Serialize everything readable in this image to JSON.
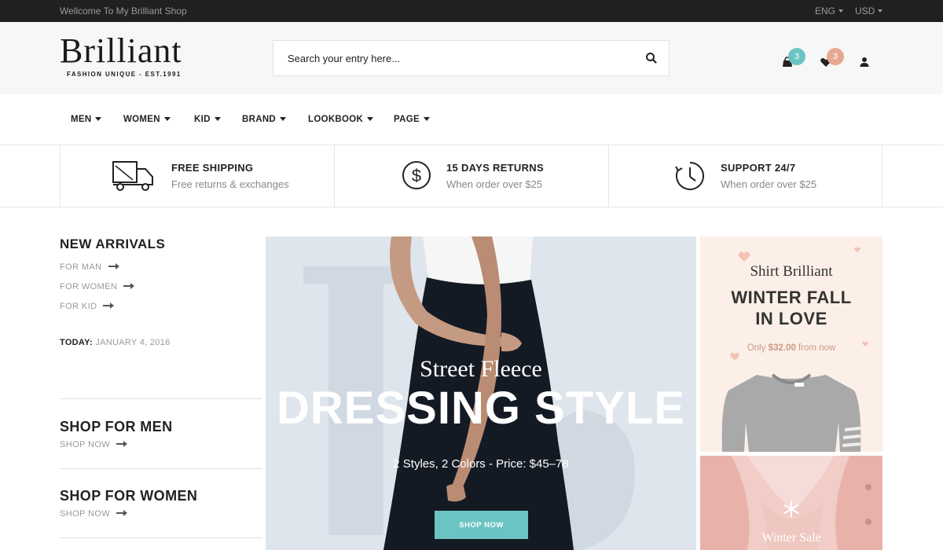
{
  "topbar": {
    "welcome": "Wellcome To My Brilliant Shop",
    "language": "ENG",
    "currency": "USD"
  },
  "header": {
    "logo_name": "Brilliant",
    "logo_tagline": "FASHION UNIQUE - EST.1991",
    "search_placeholder": "Search your entry here...",
    "cart_count": "3",
    "wishlist_count": "3"
  },
  "nav": {
    "items": [
      {
        "label": "MEN"
      },
      {
        "label": "WOMEN"
      },
      {
        "label": "KID"
      },
      {
        "label": "BRAND"
      },
      {
        "label": "LOOKBOOK"
      },
      {
        "label": "PAGE"
      }
    ]
  },
  "features": [
    {
      "icon": "truck-icon",
      "title": "FREE SHIPPING",
      "subtitle": "Free returns & exchanges"
    },
    {
      "icon": "dollar-coin-icon",
      "title": "15 DAYS RETURNS",
      "subtitle": "When order over $25"
    },
    {
      "icon": "clock-icon",
      "title": "SUPPORT 24/7",
      "subtitle": "When order over $25"
    }
  ],
  "sidebar": {
    "new_arrivals_title": "NEW ARRIVALS",
    "links": [
      {
        "label": "FOR MAN"
      },
      {
        "label": "FOR WOMEN"
      },
      {
        "label": "FOR KID"
      }
    ],
    "today_label": "TODAY:",
    "today_date": "JANUARY 4, 2016",
    "shop_sections": [
      {
        "title": "SHOP FOR MEN",
        "link": "SHOP NOW"
      },
      {
        "title": "SHOP FOR WOMEN",
        "link": "SHOP NOW"
      }
    ]
  },
  "hero": {
    "kicker": "Street Fleece",
    "headline": "DRESSING STYLE",
    "details": "2 Styles, 2 Colors - Price: $45–78",
    "button": "SHOP NOW"
  },
  "promo_top": {
    "kicker": "Shirt Brilliant",
    "headline_line1": "WINTER FALL",
    "headline_line2": "IN LOVE",
    "sub_prefix": "Only",
    "sub_price": "$32.00",
    "sub_suffix": "from now"
  },
  "promo_bottom": {
    "label": "Winter Sale"
  },
  "colors": {
    "accent": "#6cc3c3",
    "badge_cart": "#6cc3c3",
    "badge_wishlist": "#e8a88f",
    "topbar_bg": "#202020",
    "hero_bg": "#dfe5ec",
    "promo_top_bg": "#fcefe7",
    "promo_bottom_bg": "#f2ccc6"
  }
}
